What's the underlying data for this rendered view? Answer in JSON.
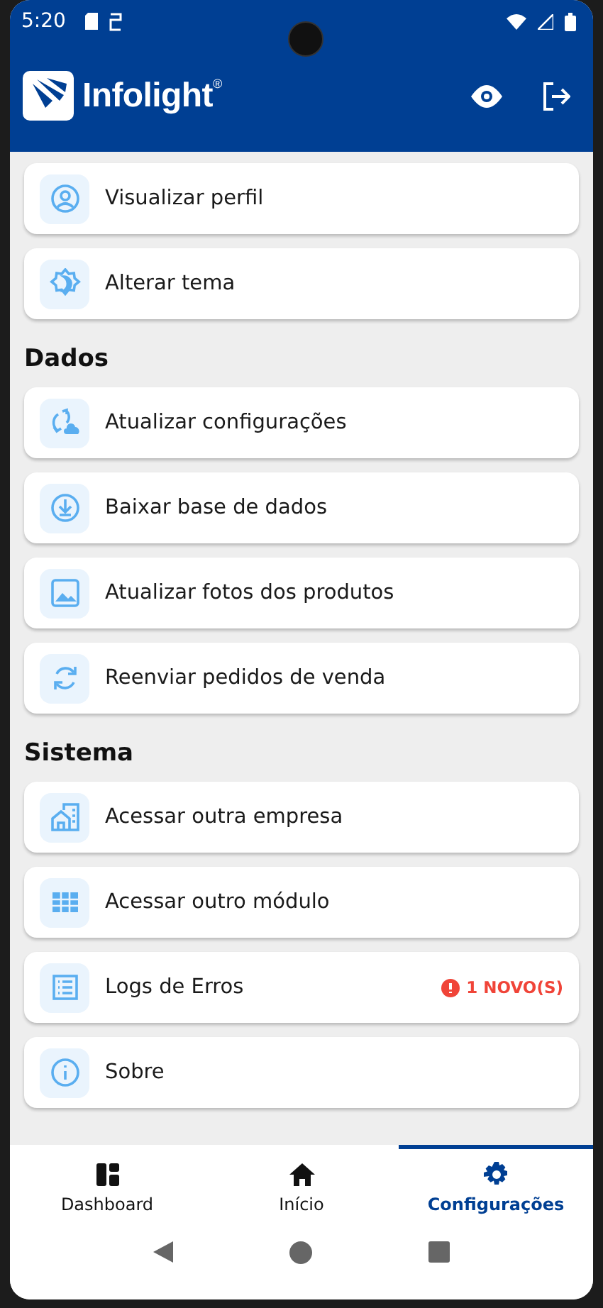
{
  "status_bar": {
    "time": "5:20"
  },
  "header": {
    "brand": "Infolight",
    "brand_mark": "®"
  },
  "sections": [
    {
      "items": [
        {
          "label": "Visualizar perfil"
        },
        {
          "label": "Alterar tema"
        }
      ]
    },
    {
      "title": "Dados",
      "items": [
        {
          "label": "Atualizar configurações"
        },
        {
          "label": "Baixar base de dados"
        },
        {
          "label": "Atualizar fotos dos produtos"
        },
        {
          "label": "Reenviar pedidos de venda"
        }
      ]
    },
    {
      "title": "Sistema",
      "items": [
        {
          "label": "Acessar outra empresa"
        },
        {
          "label": "Acessar outro módulo"
        },
        {
          "label": "Logs de Erros",
          "badge": "1 NOVO(S)"
        },
        {
          "label": "Sobre"
        }
      ]
    }
  ],
  "bottom_nav": [
    {
      "label": "Dashboard",
      "selected": false
    },
    {
      "label": "Início",
      "selected": false
    },
    {
      "label": "Configurações",
      "selected": true
    }
  ]
}
